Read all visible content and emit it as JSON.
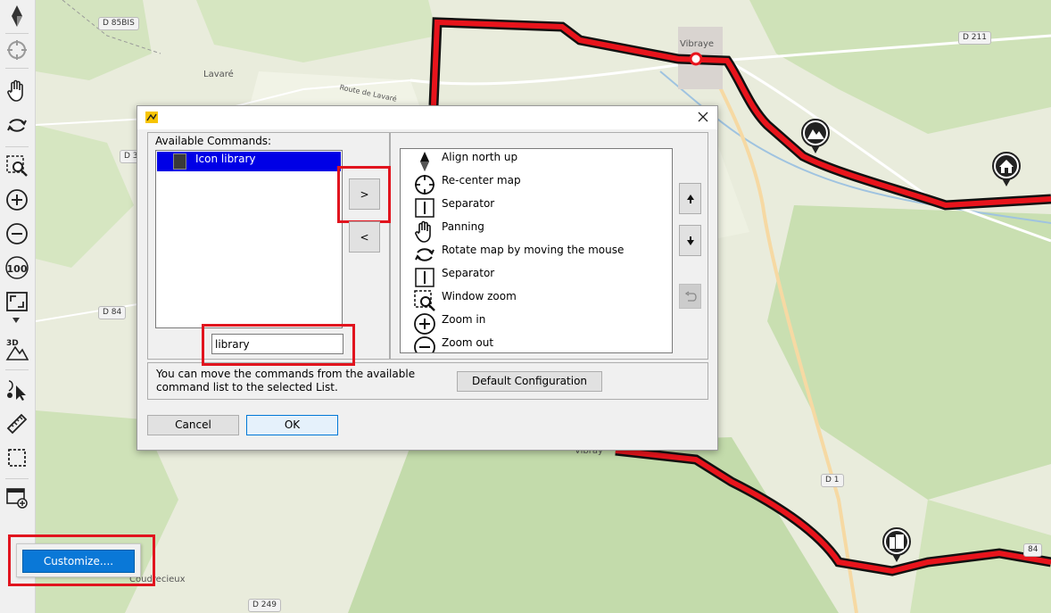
{
  "map": {
    "place_labels": [
      "Lavaré",
      "Vibraye",
      "Coudrecieux",
      "Vibray"
    ],
    "road_labels": [
      "Route de Lavaré"
    ],
    "road_signs": [
      "D 85BIS",
      "D 211",
      "D 3",
      "D 84",
      "D 1",
      "D 249",
      "84"
    ],
    "poi_icons": [
      "mountain-poi-icon",
      "home-poi-icon",
      "building-poi-icon"
    ],
    "route_color": "#e8141c"
  },
  "toolbar": {
    "items": [
      {
        "name": "align-north-tool",
        "icon": "compass-needle-icon"
      },
      {
        "name": "recenter-tool",
        "icon": "crosshair-icon"
      },
      {
        "name": "panning-tool",
        "icon": "hand-icon"
      },
      {
        "name": "rotate-tool",
        "icon": "rotate-arrows-icon"
      },
      {
        "name": "window-zoom-tool",
        "icon": "window-zoom-icon"
      },
      {
        "name": "zoom-in-tool",
        "icon": "zoom-in-icon"
      },
      {
        "name": "zoom-out-tool",
        "icon": "zoom-out-icon"
      },
      {
        "name": "zoom-100-tool",
        "icon": "zoom-100-icon",
        "text": "100"
      },
      {
        "name": "fit-window-tool",
        "icon": "fit-window-icon"
      },
      {
        "name": "3d-view-tool",
        "icon": "3d-mountain-icon",
        "text": "3D"
      },
      {
        "name": "select-tool",
        "icon": "select-pointer-icon"
      },
      {
        "name": "measure-tool",
        "icon": "ruler-icon"
      },
      {
        "name": "rectangle-select-tool",
        "icon": "dashed-rect-icon"
      },
      {
        "name": "add-window-tool",
        "icon": "add-window-icon"
      }
    ]
  },
  "customize": {
    "button_label": "Customize...."
  },
  "dialog": {
    "available_label": "Available Commands:",
    "available_items": [
      {
        "label": "Icon library",
        "selected": true
      }
    ],
    "filter_value": "library",
    "add_button": ">",
    "remove_button": "<",
    "selected_items": [
      {
        "label": "Align north up",
        "icon": "north-arrow-icon"
      },
      {
        "label": "Re-center map",
        "icon": "crosshair-icon"
      },
      {
        "label": "Separator",
        "icon": "separator-icon"
      },
      {
        "label": "Panning",
        "icon": "hand-icon"
      },
      {
        "label": "Rotate map by moving the mouse",
        "icon": "rotate-arrows-icon"
      },
      {
        "label": "Separator",
        "icon": "separator-icon"
      },
      {
        "label": "Window zoom",
        "icon": "window-zoom-icon"
      },
      {
        "label": "Zoom in",
        "icon": "zoom-in-icon"
      },
      {
        "label": "Zoom out",
        "icon": "zoom-out-icon"
      }
    ],
    "move_up_icon": "arrow-up-icon",
    "move_down_icon": "arrow-down-icon",
    "reset_icon": "undo-icon",
    "hint_text": "You can move the commands from the available command list to the selected List.",
    "default_button": "Default Configuration",
    "cancel_button": "Cancel",
    "ok_button": "OK"
  }
}
